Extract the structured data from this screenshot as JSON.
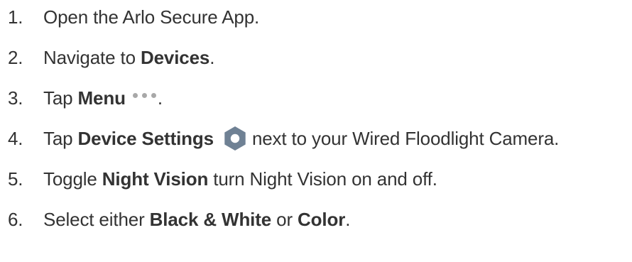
{
  "steps": [
    {
      "number": "1.",
      "text": "Open the Arlo Secure App."
    },
    {
      "number": "2.",
      "before": "Navigate to ",
      "bold": "Devices",
      "after": "."
    },
    {
      "number": "3.",
      "before": "Tap ",
      "bold": "Menu",
      "after": ".",
      "icon": "ellipsis-icon"
    },
    {
      "number": "4.",
      "before": "Tap ",
      "bold": "Device Settings",
      "after": "next to your Wired Floodlight Camera.",
      "icon": "gear-icon"
    },
    {
      "number": "5.",
      "before": "Toggle ",
      "bold": "Night Vision",
      "after": " turn Night Vision on and off."
    },
    {
      "number": "6.",
      "before": "Select either ",
      "bold": "Black & White",
      "middle": " or ",
      "bold2": "Color",
      "after": "."
    }
  ],
  "colors": {
    "text": "#333333",
    "icon_dots": "#a8a8a8",
    "icon_gear": "#6f8194"
  }
}
